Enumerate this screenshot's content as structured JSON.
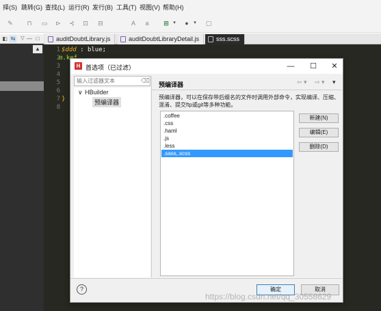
{
  "menu": [
    "择(S)",
    "跳转(G)",
    "查找(L)",
    "运行(R)",
    "发行(B)",
    "工具(T)",
    "视图(V)",
    "帮助(H)"
  ],
  "tabs": [
    "auditDoubtLibrary.js",
    "auditDoubtLibraryDetail.js",
    "sss.scss"
  ],
  "editor": {
    "line_numbers": [
      "1",
      "2",
      "3",
      "4",
      "5",
      "6",
      "7",
      "8"
    ],
    "line1_var": "$ddd",
    "line1_rest": " : blue;",
    "line2_fold": "⊟",
    "line2_text": ".kef",
    "line7_text": "}"
  },
  "dialog": {
    "title": "首选项（已过滤）",
    "minimize": "—",
    "maximize": "☐",
    "close": "✕",
    "filter_placeholder": "输入过滤器文本",
    "tree": {
      "root_toggle": "∨",
      "root": "HBuilder",
      "child": "预编译器"
    },
    "pane": {
      "title": "预编译器",
      "description": "预编译器，可以在保存带后缀名的文件时调用外部命令，实现编译、压缩、混淆、提交ftp或git等多种功能。",
      "list": [
        ".coffee",
        ".css",
        ".haml",
        ".js",
        ".less",
        ".sass,.scss"
      ],
      "selected_index": 5,
      "buttons": {
        "new": "新建(N)",
        "edit": "编辑(E)",
        "delete": "删除(D)"
      }
    },
    "footer": {
      "help": "?",
      "ok": "确定",
      "cancel": "取消"
    }
  },
  "watermark": "https://blog.csdn.net/qq_30558629",
  "colors": {
    "accent": "#3399ff",
    "editor_bg": "#272822",
    "logo": "#d32f2f"
  }
}
